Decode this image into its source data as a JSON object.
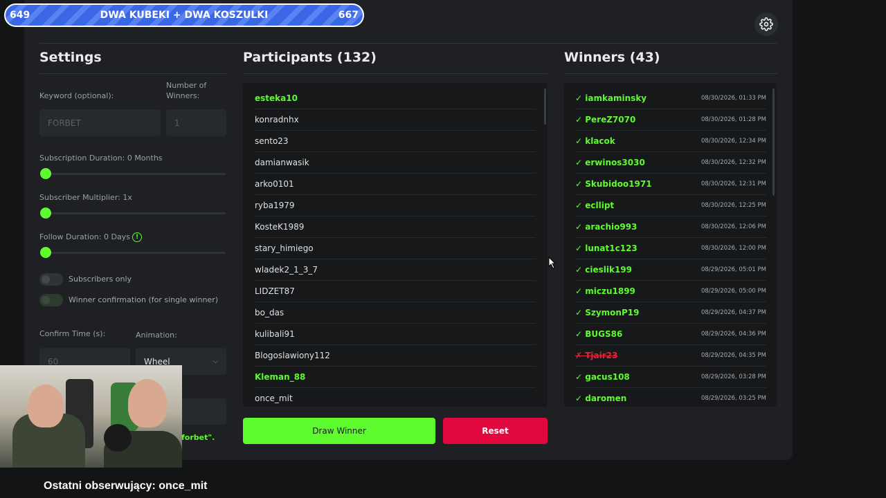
{
  "banner": {
    "left_count": "649",
    "title": "DWA KUBEKI + DWA KOSZULKI",
    "right_count": "667"
  },
  "settings": {
    "title": "Settings",
    "keyword_label": "Keyword (optional):",
    "keyword_placeholder": "FORBET",
    "winners_label": "Number of Winners:",
    "winners_value": "1",
    "sub_duration_label": "Subscription Duration: 0 Months",
    "sub_multiplier_label": "Subscriber Multiplier: 1x",
    "follow_duration_label": "Follow Duration:  0  Days",
    "subscribers_only_label": "Subscribers only",
    "winner_confirmation_label": "Winner confirmation (for single winner)",
    "confirm_time_label": "Confirm Time (s):",
    "confirm_time_value": "60",
    "animation_label": "Animation:",
    "animation_value": "Wheel",
    "keyword_hint_fragment": "forbet\"."
  },
  "participants": {
    "title": "Participants (132)",
    "items": [
      {
        "name": "esteka10",
        "highlight": true
      },
      {
        "name": "konradnhx",
        "highlight": false
      },
      {
        "name": "sento23",
        "highlight": false
      },
      {
        "name": "damianwasik",
        "highlight": false
      },
      {
        "name": "arko0101",
        "highlight": false
      },
      {
        "name": "ryba1979",
        "highlight": false
      },
      {
        "name": "KosteK1989",
        "highlight": false
      },
      {
        "name": "stary_himiego",
        "highlight": false
      },
      {
        "name": "wladek2_1_3_7",
        "highlight": false
      },
      {
        "name": "LIDZET87",
        "highlight": false
      },
      {
        "name": "bo_das",
        "highlight": false
      },
      {
        "name": "kulibali91",
        "highlight": false
      },
      {
        "name": "Blogoslawiony112",
        "highlight": false
      },
      {
        "name": "Kleman_88",
        "highlight": true
      },
      {
        "name": "once_mit",
        "highlight": false
      }
    ]
  },
  "winners": {
    "title": "Winners (43)",
    "items": [
      {
        "name": "✓ iamkaminsky",
        "date": "08/30/2026, 01:33 PM",
        "rejected": false
      },
      {
        "name": "✓ PereZ7070",
        "date": "08/30/2026, 01:28 PM",
        "rejected": false
      },
      {
        "name": "✓ klacok",
        "date": "08/30/2026, 12:34 PM",
        "rejected": false
      },
      {
        "name": "✓ erwinos3030",
        "date": "08/30/2026, 12:32 PM",
        "rejected": false
      },
      {
        "name": "✓ Skubidoo1971",
        "date": "08/30/2026, 12:31 PM",
        "rejected": false
      },
      {
        "name": "✓ ecllipt",
        "date": "08/30/2026, 12:25 PM",
        "rejected": false
      },
      {
        "name": "✓ arachio993",
        "date": "08/30/2026, 12:06 PM",
        "rejected": false
      },
      {
        "name": "✓ lunat1c123",
        "date": "08/30/2026, 12:00 PM",
        "rejected": false
      },
      {
        "name": "✓ cieslik199",
        "date": "08/29/2026, 05:01 PM",
        "rejected": false
      },
      {
        "name": "✓ miczu1899",
        "date": "08/29/2026, 05:00 PM",
        "rejected": false
      },
      {
        "name": "✓ SzymonP19",
        "date": "08/29/2026, 04:37 PM",
        "rejected": false
      },
      {
        "name": "✓ BUGS86",
        "date": "08/29/2026, 04:36 PM",
        "rejected": false
      },
      {
        "name": "✗ Tjair23",
        "date": "08/29/2026, 04:35 PM",
        "rejected": true
      },
      {
        "name": "✓ gacus108",
        "date": "08/29/2026, 03:28 PM",
        "rejected": false
      },
      {
        "name": "✓ daromen",
        "date": "08/29/2026, 03:25 PM",
        "rejected": false
      }
    ]
  },
  "actions": {
    "draw_label": "Draw Winner",
    "reset_label": "Reset"
  },
  "footer": {
    "text": "Ostatni obserwujący: once_mit"
  },
  "colors": {
    "accent": "#5efc2e",
    "danger": "#e1083f",
    "panel": "#1e2023",
    "background": "#121416"
  }
}
